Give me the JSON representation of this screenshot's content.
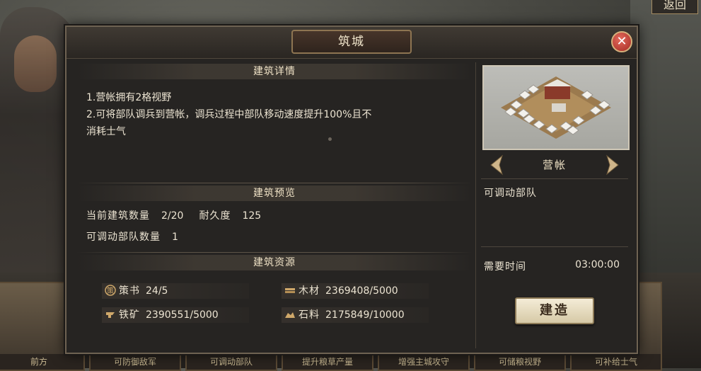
{
  "background": {
    "return_label": "返回",
    "cards": [
      "前方",
      "可防御敌军",
      "可调动部队",
      "提升粮草产量",
      "增强主城攻守",
      "可储粮视野",
      "可补给士气"
    ]
  },
  "dialog": {
    "title": "筑城",
    "close_glyph": "✕",
    "details": {
      "header": "建筑详情",
      "lines": [
        "1.营帐拥有2格视野",
        "2.可将部队调兵到营帐，调兵过程中部队移动速度提升100%且不",
        "消耗士气"
      ]
    },
    "preview": {
      "header": "建筑预览",
      "count_label": "当前建筑数量",
      "count_value": "2/20",
      "durability_label": "耐久度",
      "durability_value": "125",
      "troops_label": "可调动部队数量",
      "troops_value": "1"
    },
    "resources": {
      "header": "建筑资源",
      "items": [
        {
          "icon": "strategy-book-icon",
          "label": "策书",
          "value": "24/5"
        },
        {
          "icon": "wood-icon",
          "label": "木材",
          "value": "2369408/5000"
        },
        {
          "icon": "iron-icon",
          "label": "铁矿",
          "value": "2390551/5000"
        },
        {
          "icon": "stone-icon",
          "label": "石料",
          "value": "2175849/10000"
        }
      ]
    },
    "building": {
      "name": "营帐",
      "description": "可调动部队",
      "time_label": "需要时间",
      "time_value": "03:00:00",
      "build_label": "建造"
    }
  },
  "colors": {
    "panel_bg": "#262422",
    "accent_gold": "#8e7552",
    "text": "#ece4d2",
    "close_red": "#a52a22"
  }
}
